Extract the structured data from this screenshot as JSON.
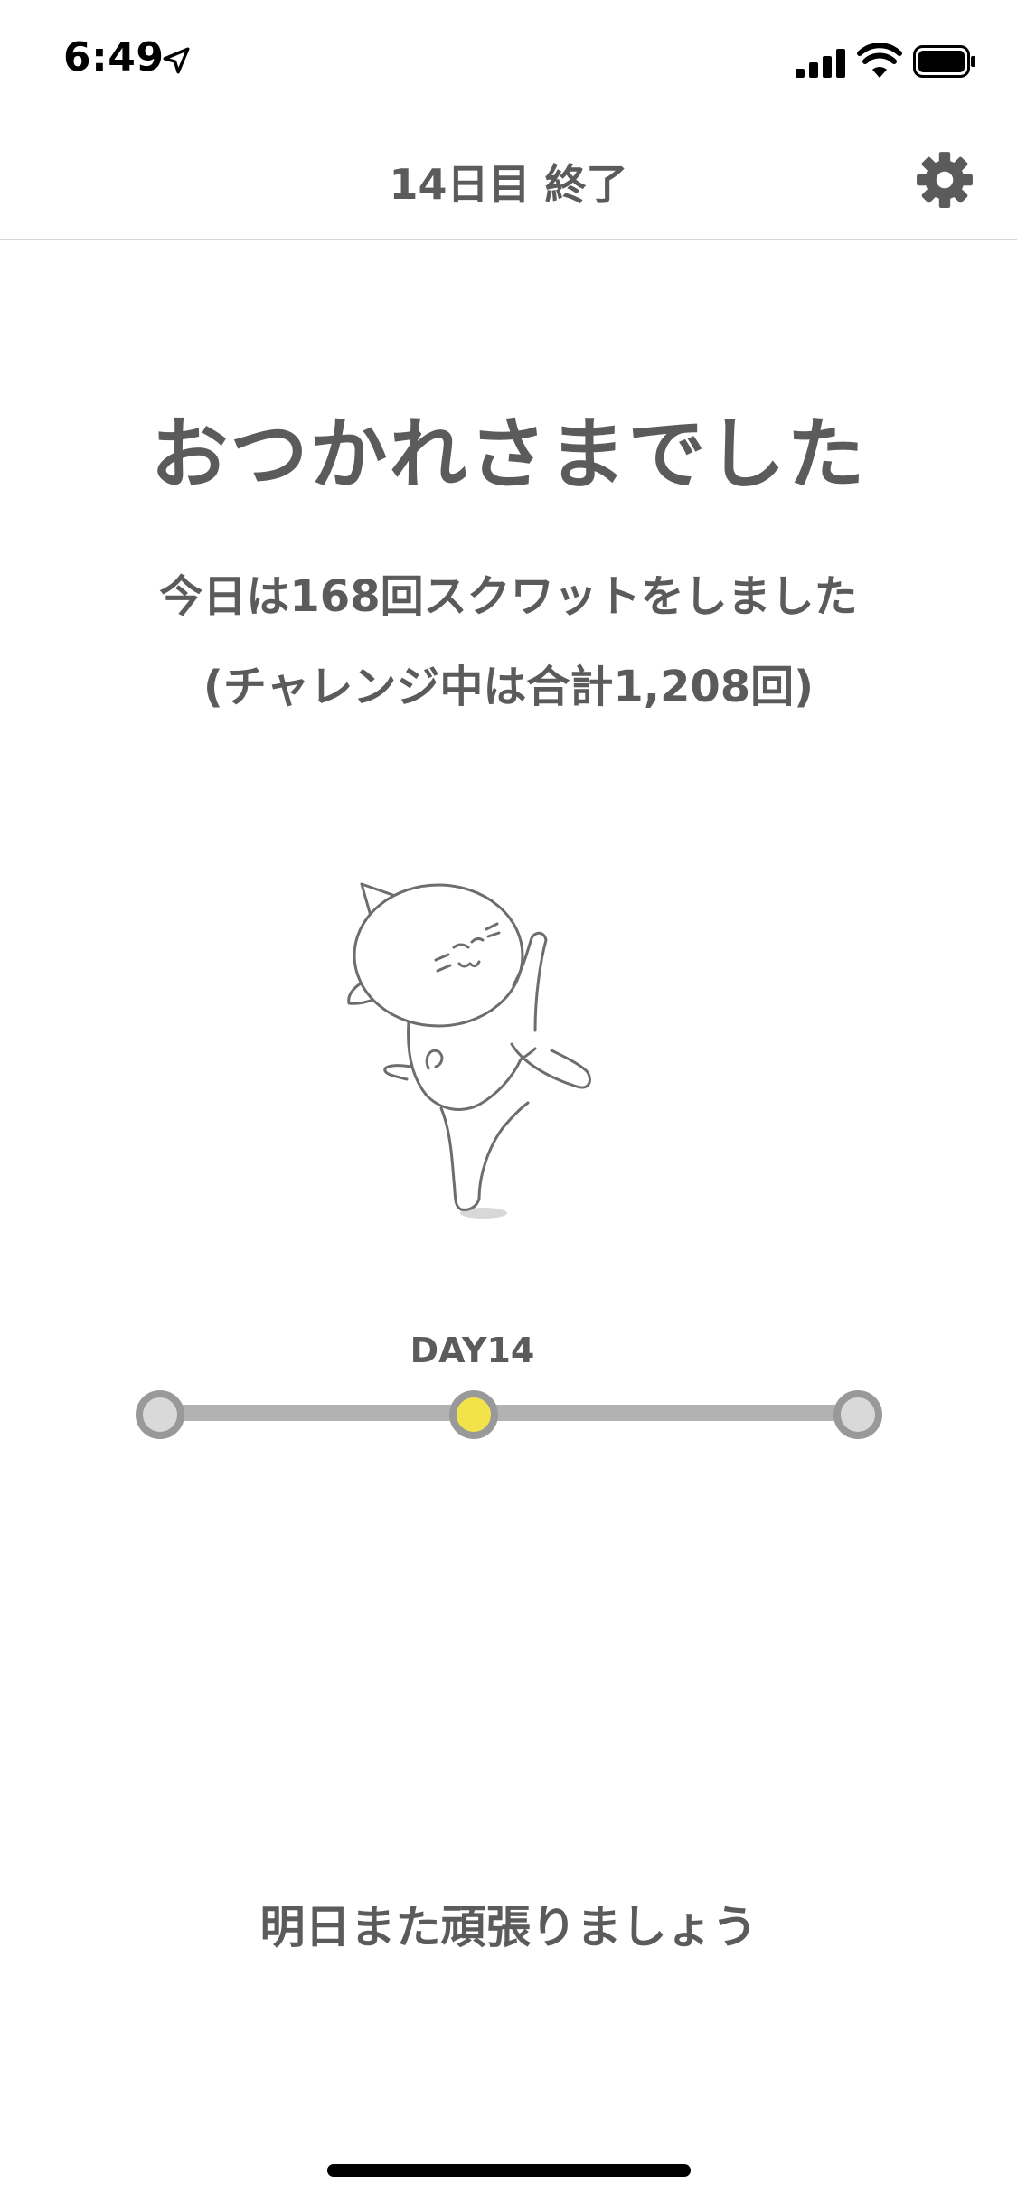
{
  "status_bar": {
    "time": "6:49",
    "icons": [
      "location-arrow-icon",
      "signal-bars-icon",
      "wifi-icon",
      "battery-icon"
    ]
  },
  "nav": {
    "title": "14日目 終了",
    "settings_icon": "gear-icon"
  },
  "main": {
    "headline": "おつかれさまでした",
    "summary_line1": "今日は168回スクワットをしました",
    "summary_line2": "(チャレンジ中は合計1,208回)",
    "illustration": "cat-mascot-kicking"
  },
  "progress": {
    "day_label": "DAY14",
    "current_node": 2,
    "node_count": 3
  },
  "footer": {
    "message": "明日また頑張りましょう"
  },
  "colors": {
    "text": "#5b5b5b",
    "track": "#b2b2b2",
    "node_border": "#999999",
    "node_fill": "#d9d9d9",
    "active_node": "#f3e34a"
  }
}
